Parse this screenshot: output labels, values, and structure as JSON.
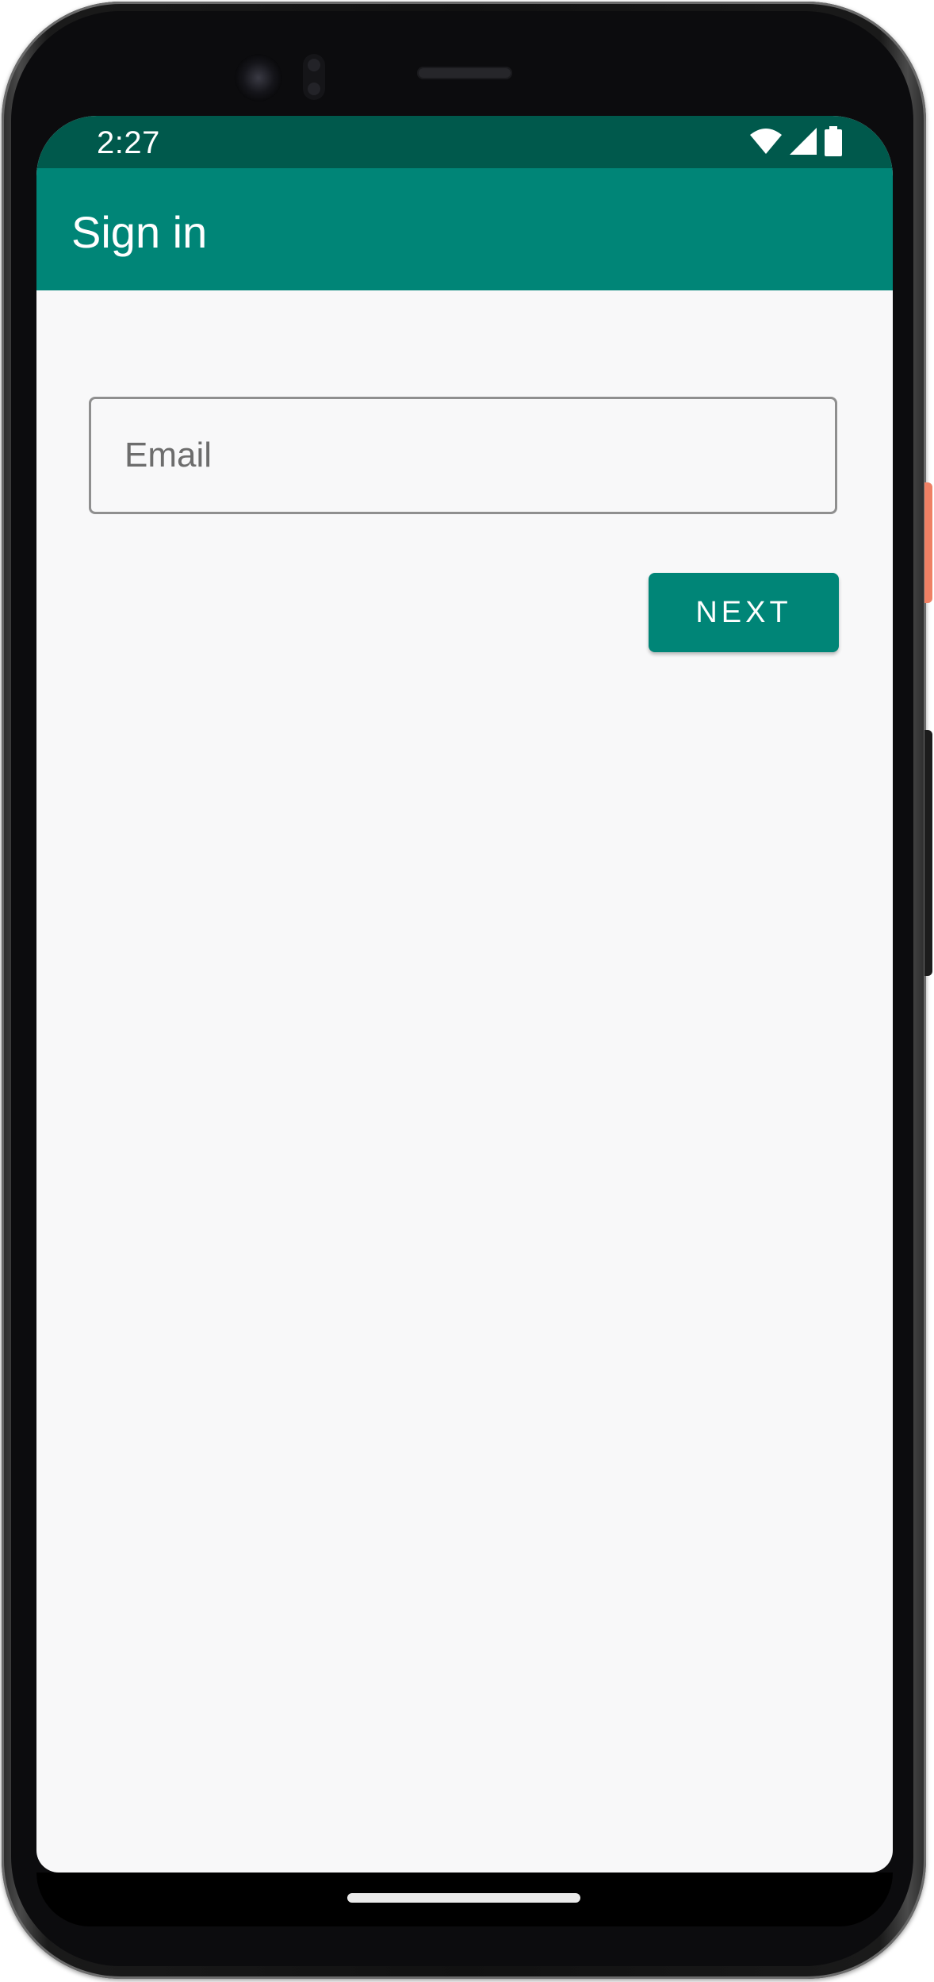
{
  "status_bar": {
    "time": "2:27",
    "icons": [
      "wifi-icon",
      "cellular-signal-icon",
      "battery-icon"
    ]
  },
  "app_bar": {
    "title": "Sign in"
  },
  "form": {
    "email_placeholder": "Email",
    "email_value": "",
    "next_label": "NEXT"
  },
  "colors": {
    "status_bar": "#00594c",
    "primary": "#008577",
    "background": "#f8f8f9",
    "on_primary": "#ffffff"
  }
}
